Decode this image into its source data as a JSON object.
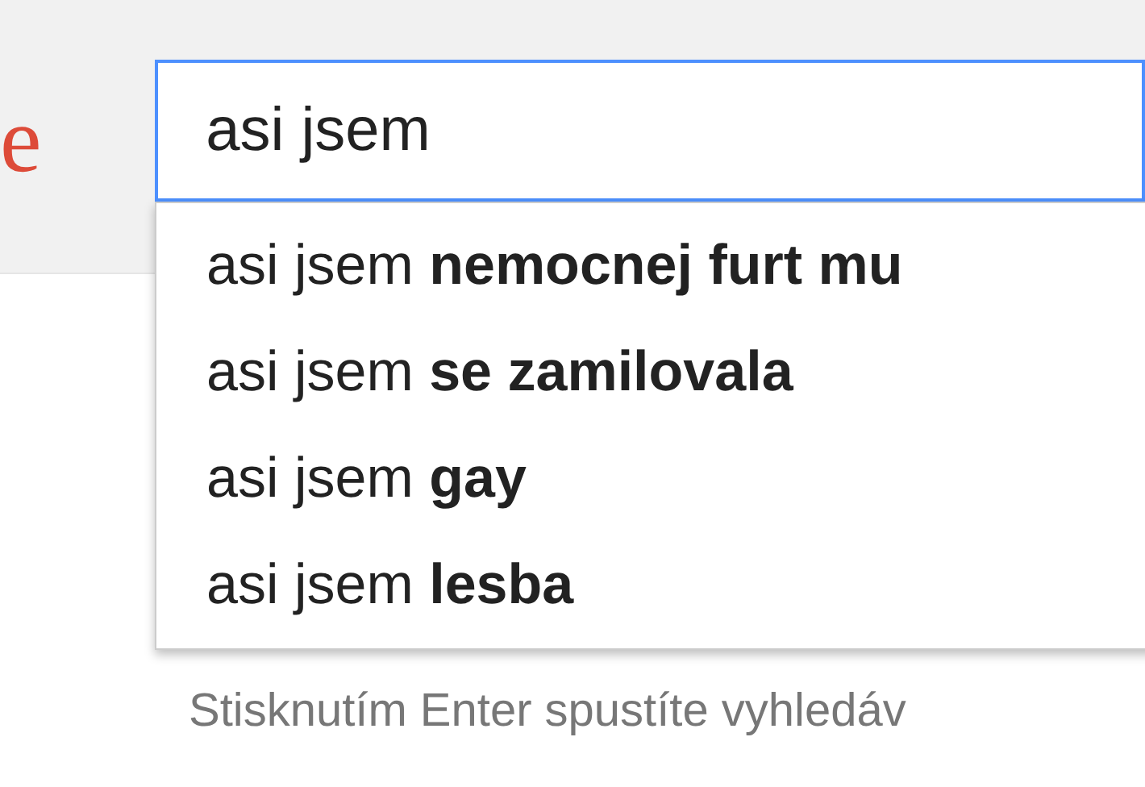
{
  "logo": "e",
  "search": {
    "value": "asi jsem"
  },
  "suggestions": [
    {
      "text": "asi jsem **nemocnej furt mu**"
    },
    {
      "text": "asi jsem **se zamilovala**"
    },
    {
      "text": "asi jsem **gay**"
    },
    {
      "text": "asi jsem **lesba**"
    }
  ],
  "hint": "Stisknutím Enter spustíte vyhledáv"
}
